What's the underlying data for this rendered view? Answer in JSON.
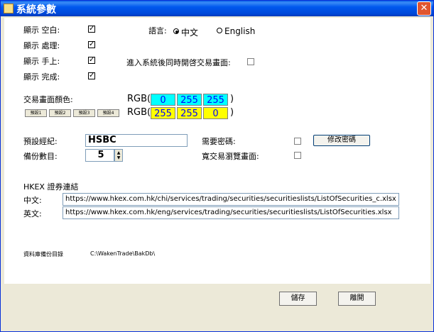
{
  "window": {
    "title": "系統參數",
    "close_glyph": "✕"
  },
  "display": {
    "items": [
      {
        "label": "顯示 空白:",
        "checked": true
      },
      {
        "label": "顯示 處理:",
        "checked": true
      },
      {
        "label": "顯示 手上:",
        "checked": true
      },
      {
        "label": "顯示 完成:",
        "checked": true
      }
    ],
    "check_glyph": "✓"
  },
  "language": {
    "label": "語言:",
    "options": [
      {
        "label": "中文",
        "selected": true
      },
      {
        "label": "English",
        "selected": false
      }
    ]
  },
  "open_trade_screen": {
    "label": "進入系統後同時開啓交易畫面:",
    "checked": false
  },
  "trade_color": {
    "label": "交易畫面顏色:",
    "rows": [
      {
        "prefix": "RGB(",
        "values": [
          "0",
          "255",
          "255"
        ],
        "suffix": ")",
        "color": "#00ffff"
      },
      {
        "prefix": "RGB(",
        "values": [
          "255",
          "255",
          "0"
        ],
        "suffix": ")",
        "color": "#ffff00"
      }
    ],
    "presets": [
      "預設1",
      "預設2",
      "預設3",
      "預設4"
    ]
  },
  "broker": {
    "label": "預設經紀:",
    "value": "HSBC"
  },
  "backup_count": {
    "label": "備份數目:",
    "value": "5"
  },
  "password": {
    "label": "需要密碼:",
    "checked": false,
    "button": "修改密碼"
  },
  "wide_view": {
    "label": "寬交易瀏覽畫面:",
    "checked": false
  },
  "hkex": {
    "title": "HKEX 證券連結",
    "chinese_label": "中文:",
    "chinese_url": "https://www.hkex.com.hk/chi/services/trading/securities/securitieslists/ListOfSecurities_c.xlsx",
    "english_label": "英文:",
    "english_url": "https://www.hkex.com.hk/eng/services/trading/securities/securitieslists/ListOfSecurities.xlsx"
  },
  "backup_dir": {
    "label": "資料庫備份目錄",
    "value": "C:\\WakenTrade\\BakDb\\"
  },
  "footer": {
    "save": "儲存",
    "close": "離開"
  }
}
